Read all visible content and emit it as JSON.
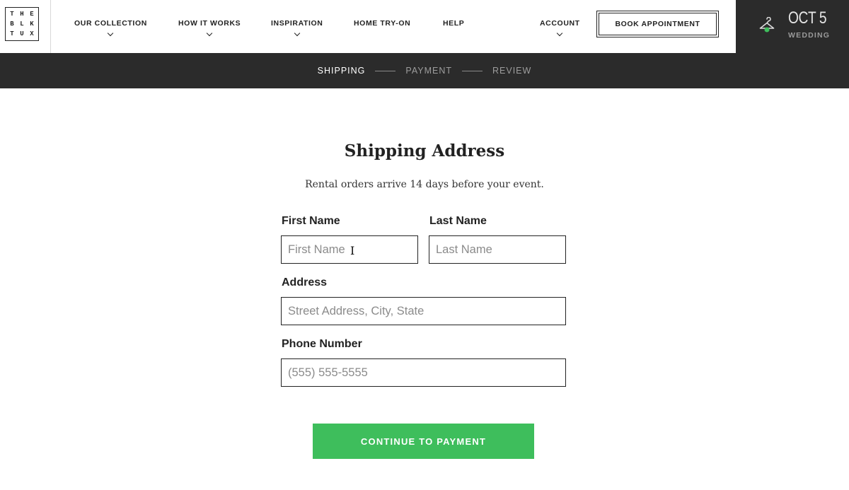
{
  "logo": {
    "letters": [
      "T",
      "H",
      "E",
      "B",
      "L",
      "K",
      "T",
      "U",
      "X"
    ]
  },
  "nav": {
    "our_collection": "Our Collection",
    "how_it_works": "How It Works",
    "inspiration": "Inspiration",
    "home_try_on": "Home Try-On",
    "help": "Help",
    "account": "Account",
    "book_appointment": "Book Appointment"
  },
  "event": {
    "date": "OCT 5",
    "type": "Wedding",
    "indicator_color": "#3ebe5c"
  },
  "steps": [
    {
      "label": "Shipping",
      "active": true
    },
    {
      "label": "Payment",
      "active": false
    },
    {
      "label": "Review",
      "active": false
    }
  ],
  "form": {
    "title": "Shipping Address",
    "subtitle": "Rental orders arrive 14 days before your event.",
    "first_name": {
      "label": "First Name",
      "placeholder": "First Name",
      "value": ""
    },
    "last_name": {
      "label": "Last Name",
      "placeholder": "Last Name",
      "value": ""
    },
    "address": {
      "label": "Address",
      "placeholder": "Street Address, City, State",
      "value": ""
    },
    "phone": {
      "label": "Phone Number",
      "placeholder": "(555) 555-5555",
      "value": ""
    },
    "submit": "Continue to Payment"
  },
  "colors": {
    "accent": "#3ebe5c",
    "dark_bar": "#2b2b2b"
  }
}
